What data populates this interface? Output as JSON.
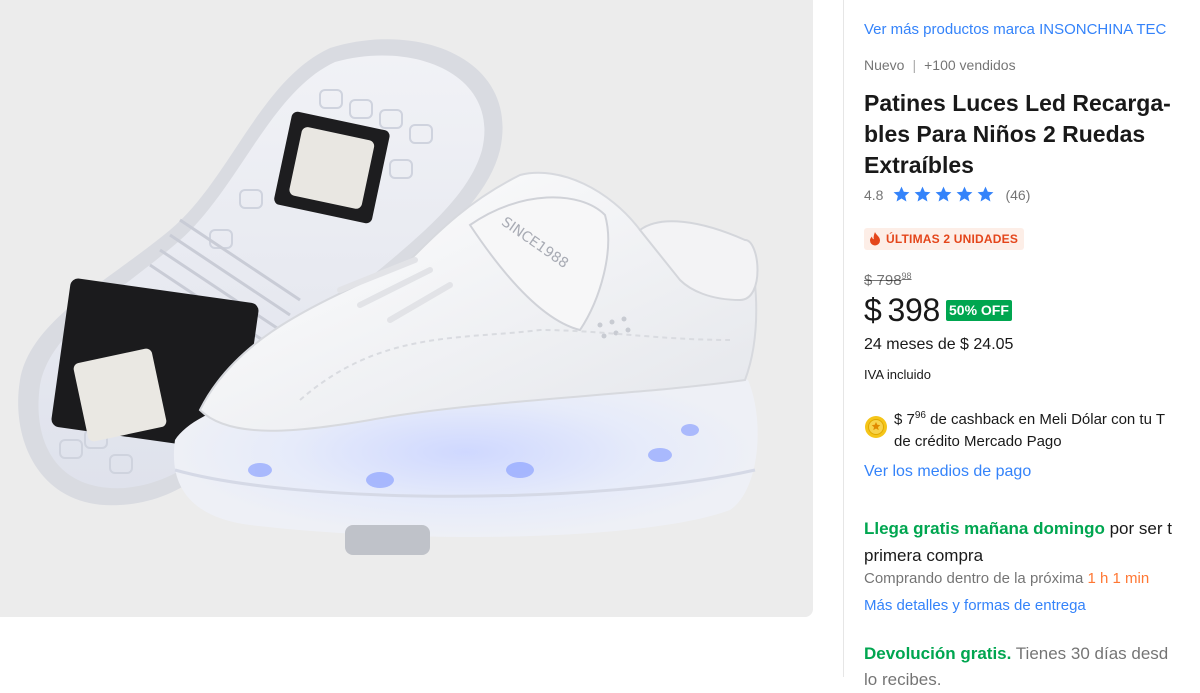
{
  "gallery": {
    "image_alt": "Patines con luces LED blancos",
    "print_text": "SINCE1988"
  },
  "product": {
    "brand_link": "Ver más productos marca INSONCHINA TEC",
    "condition": "Nuevo",
    "sold": "+100 vendidos",
    "title": "Patines Luces Led Recarga-bles Para Niños 2 Ruedas Extraíbles",
    "rating": {
      "score": "4.8",
      "stars": 5,
      "count": "(46)"
    },
    "urgency": "ÚLTIMAS 2 UNIDADES",
    "old_price": {
      "currency": "$",
      "whole": "798",
      "cents": "98"
    },
    "price": {
      "currency": "$",
      "whole": "398"
    },
    "discount": "50% OFF",
    "installments": "24 meses de $ 24.05",
    "tax": "IVA incluido",
    "cashback": {
      "amount_whole": "$ 7",
      "amount_cents": "96",
      "line1_rest": " de cashback en Meli Dólar con tu T",
      "line2": "de crédito Mercado Pago"
    },
    "payment_link": "Ver los medios de pago",
    "shipping": {
      "highlight": "Llega gratis mañana domingo",
      "rest": " por ser t",
      "line2": "primera compra",
      "countdown_prefix": "Comprando dentro de la próxima ",
      "countdown_time": "1 h 1 min",
      "link": "Más detalles y formas de entrega"
    },
    "returns": {
      "highlight": "Devolución gratis.",
      "rest": " Tienes 30 días desd",
      "line2": "lo recibes."
    }
  },
  "colors": {
    "link": "#3483fa",
    "green": "#00a650",
    "urgency": "#e4461b",
    "urgency_bg": "#fdeee7",
    "stars": "#3483fa",
    "countdown": "#ff7733"
  },
  "icons": [
    "star-icon",
    "flame-icon",
    "coin-icon"
  ]
}
